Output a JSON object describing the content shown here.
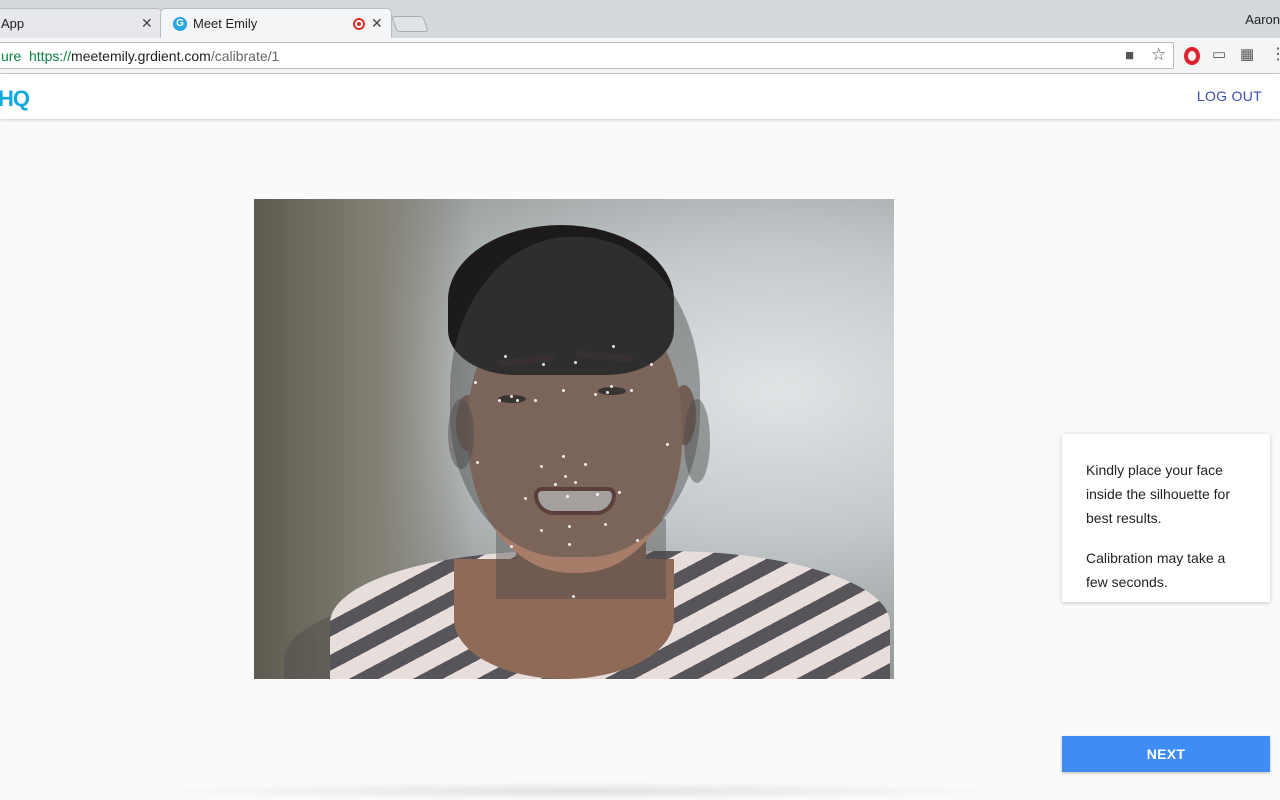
{
  "browser": {
    "tabs": [
      {
        "title": "App",
        "active": false
      },
      {
        "title": "Meet Emily",
        "active": true
      }
    ],
    "profile_name": "Aaron",
    "url": {
      "secure_label": "ure",
      "protocol": "https://",
      "host": "meetemily.grdient.com",
      "path": "/calibrate/1"
    },
    "tab_icons": [
      "grdient-favicon",
      "recording-icon",
      "close-icon"
    ],
    "toolbar_icons": [
      "camera-icon",
      "star-icon",
      "opera-icon",
      "cast-icon",
      "extension-icon",
      "menu-icon"
    ]
  },
  "app": {
    "logo": "HQ",
    "logout_label": "LOG OUT",
    "accent_color": "#12a9e0"
  },
  "calibration": {
    "instruction_1": "Kindly place your face inside the silhouette for best results.",
    "instruction_2": "Calibration may take a few seconds.",
    "next_label": "NEXT",
    "button_color": "#3f8cf5"
  }
}
